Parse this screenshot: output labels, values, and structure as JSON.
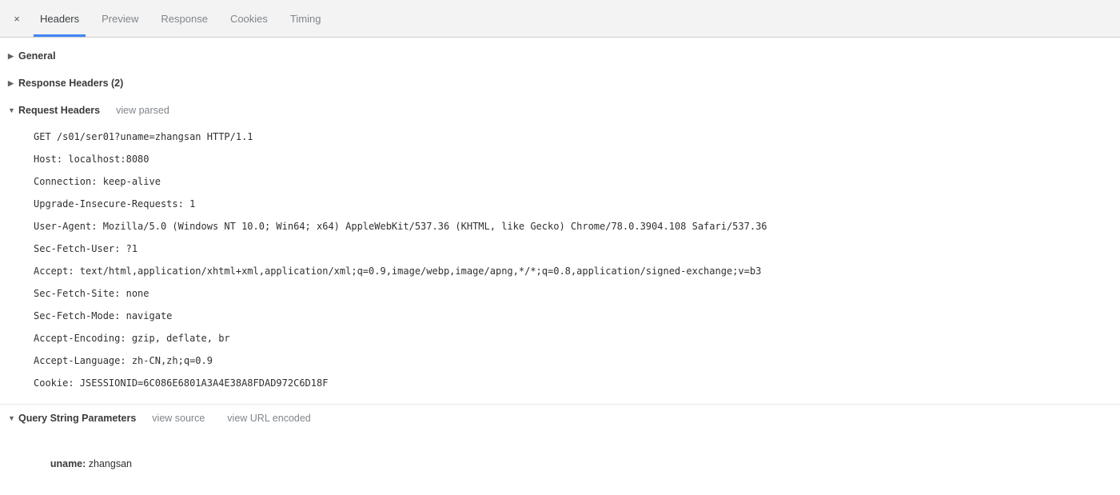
{
  "tabbar": {
    "close_label": "×",
    "tabs": [
      {
        "label": "Headers",
        "active": true
      },
      {
        "label": "Preview",
        "active": false
      },
      {
        "label": "Response",
        "active": false
      },
      {
        "label": "Cookies",
        "active": false
      },
      {
        "label": "Timing",
        "active": false
      }
    ],
    "accent_color": "#4285f4",
    "background": "#f3f3f3"
  },
  "sections": {
    "general": {
      "title": "General",
      "arrow": "▶",
      "expanded": false
    },
    "response_headers": {
      "title": "Response Headers (2)",
      "arrow": "▶",
      "expanded": false
    },
    "request_headers": {
      "title": "Request Headers",
      "arrow": "▼",
      "expanded": true,
      "action_label": "view parsed",
      "rows": [
        "GET /s01/ser01?uname=zhangsan HTTP/1.1",
        "Host: localhost:8080",
        "Connection: keep-alive",
        "Upgrade-Insecure-Requests: 1",
        "User-Agent: Mozilla/5.0 (Windows NT 10.0; Win64; x64) AppleWebKit/537.36 (KHTML, like Gecko) Chrome/78.0.3904.108 Safari/537.36",
        "Sec-Fetch-User: ?1",
        "Accept: text/html,application/xhtml+xml,application/xml;q=0.9,image/webp,image/apng,*/*;q=0.8,application/signed-exchange;v=b3",
        "Sec-Fetch-Site: none",
        "Sec-Fetch-Mode: navigate",
        "Accept-Encoding: gzip, deflate, br",
        "Accept-Language: zh-CN,zh;q=0.9",
        "Cookie: JSESSIONID=6C086E6801A3A4E38A8FDAD972C6D18F"
      ]
    },
    "query_string_parameters": {
      "title": "Query String Parameters",
      "arrow": "▼",
      "expanded": true,
      "action_label_1": "view source",
      "action_label_2": "view URL encoded",
      "params": [
        {
          "name": "uname:",
          "value": " zhangsan"
        }
      ]
    }
  }
}
